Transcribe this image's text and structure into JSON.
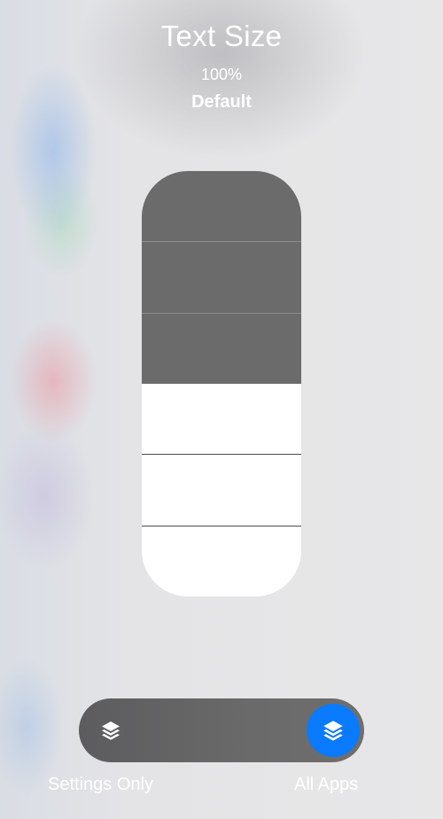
{
  "header": {
    "title": "Text Size",
    "percent": "100%",
    "level": "Default"
  },
  "slider": {
    "segments": 6,
    "selected_index": 4,
    "filled_segments": 3,
    "fill_color": "#ffffff",
    "track_color": "#6b6b6b"
  },
  "scope_toggle": {
    "left_icon": "layers-icon",
    "right_icon": "layers-icon",
    "left_label": "Settings Only",
    "right_label": "All Apps",
    "selected": "All Apps",
    "accent_color": "#0a7aff"
  }
}
